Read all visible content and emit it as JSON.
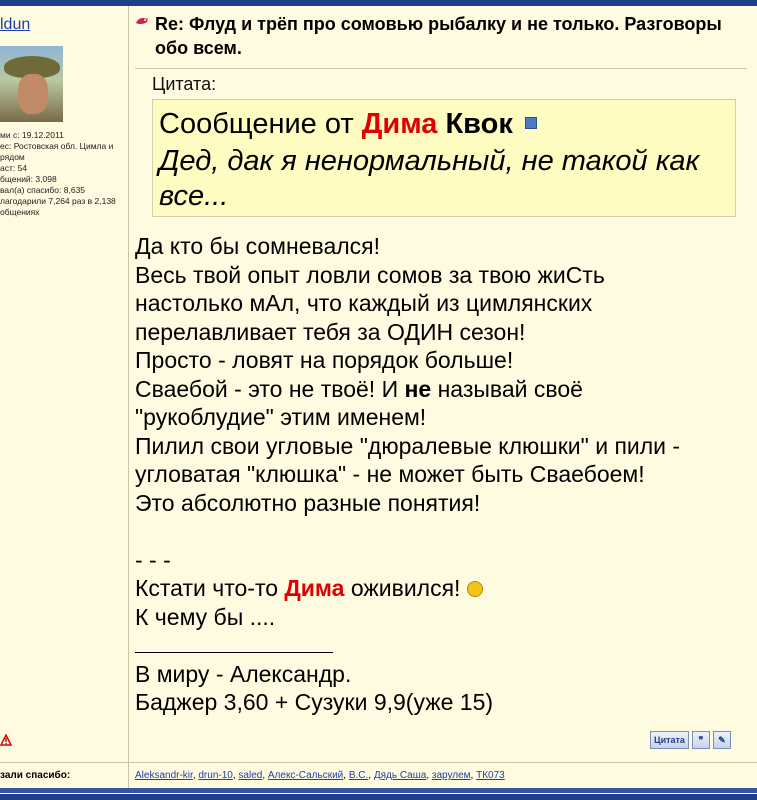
{
  "author": {
    "name": "ldun",
    "info": [
      "ми с: 19.12.2011",
      "ес: Ростовская обл. Цимла и",
      "рядом",
      "аст: 54",
      "бщений: 3,098",
      "вал(а) спасибо: 8,635",
      "лагодарили 7,264 раз в 2,138",
      "общениях"
    ]
  },
  "post": {
    "title": "Re: Флуд и трёп про сомовью рыбалку и не только. Разговоры обо всем.",
    "quote": {
      "label": "Цитата:",
      "prefix": "Сообщение от",
      "name_first": "Дима",
      "name_last": "Квок",
      "text": "Дед, дак я ненормальный, не такой как все..."
    },
    "body": {
      "l1": "Да кто бы сомневался!",
      "l2": "Весь твой опыт ловли сомов за твою жиСть",
      "l3": "настолько мАл, что каждый из цимлянских",
      "l4": "перелавливает тебя за ОДИН сезон!",
      "l5": "Просто - ловят на порядок больше!",
      "l6a": "Сваебой - это не твоё! И",
      "l6b": "не",
      "l6c": "называй своё",
      "l7": "\"рукоблудие\" этим именем!",
      "l8": "Пилил свои угловые \"дюралевые клюшки\" и пили -",
      "l9": "угловатая \"клюшка\" - не может быть Сваебоем!",
      "l10": "Это абсолютно разные понятия!",
      "l11": "- - -",
      "l12a": "Кстати что-то",
      "l12b": "Дима",
      "l12c": "оживился!",
      "l13": "К чему бы ....",
      "l14": "В миру - Александр.",
      "l15": "Баджер 3,60 + Сузуки 9,9(уже 15)"
    },
    "actions": {
      "quote_label": "Цитата"
    }
  },
  "thanks": {
    "label": "зали спасибо:",
    "users": [
      "Aleksandr-kir",
      "drun-10",
      "saled",
      "Алекс-Сальский",
      "B.C.",
      "Дядь Саша",
      "зарулем",
      "ТК073"
    ]
  },
  "colors": {
    "accent_red": "#e00000",
    "link_blue": "#1d3ea8",
    "header_navy": "#1e3f8a",
    "background": "#fffbe0"
  }
}
